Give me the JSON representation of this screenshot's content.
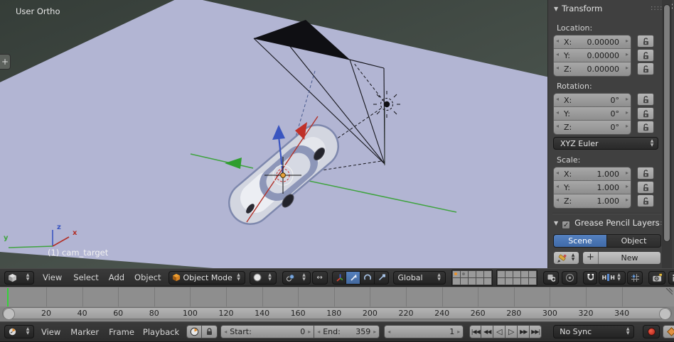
{
  "viewport": {
    "view_label": "User Ortho",
    "object_label": "(1) cam_target",
    "toolshelf_tab": "+",
    "axis_labels": {
      "x": "x",
      "y": "y",
      "z": "z"
    },
    "colors": {
      "ground_plane": "#b2b5d3",
      "selection_accent": "#e8a23c",
      "axis_x": "#b23028",
      "axis_y": "#3fa33f",
      "axis_z": "#3a55c0"
    }
  },
  "panel": {
    "transform_title": "Transform",
    "drag_dots": "::::",
    "location": {
      "label": "Location:",
      "rows": [
        {
          "axis": "X:",
          "value": "0.00000"
        },
        {
          "axis": "Y:",
          "value": "0.00000"
        },
        {
          "axis": "Z:",
          "value": "0.00000"
        }
      ]
    },
    "rotation": {
      "label": "Rotation:",
      "rows": [
        {
          "axis": "X:",
          "value": "0°"
        },
        {
          "axis": "Y:",
          "value": "0°"
        },
        {
          "axis": "Z:",
          "value": "0°"
        }
      ]
    },
    "rotation_mode": "XYZ Euler",
    "scale": {
      "label": "Scale:",
      "rows": [
        {
          "axis": "X:",
          "value": "1.000"
        },
        {
          "axis": "Y:",
          "value": "1.000"
        },
        {
          "axis": "Z:",
          "value": "1.000"
        }
      ]
    },
    "grease_pencil": {
      "title": "Grease Pencil Layers",
      "checkbox_checked": "✓",
      "tabs": [
        {
          "label": "Scene"
        },
        {
          "label": "Object"
        }
      ],
      "new_label": "New"
    }
  },
  "view3d_header": {
    "menus": [
      {
        "label": "View"
      },
      {
        "label": "Select"
      },
      {
        "label": "Add"
      },
      {
        "label": "Object"
      }
    ],
    "mode": "Object Mode",
    "orientation": "Global"
  },
  "timeline": {
    "ticks": [
      20,
      40,
      60,
      80,
      100,
      120,
      140,
      160,
      180,
      200,
      220,
      240,
      260,
      280,
      300,
      320,
      340
    ],
    "current_frame_number": 1,
    "header": {
      "menus": [
        {
          "label": "View"
        },
        {
          "label": "Marker"
        },
        {
          "label": "Frame"
        },
        {
          "label": "Playback"
        }
      ],
      "start_label": "Start:",
      "start_value": "0",
      "end_label": "End:",
      "end_value": "359",
      "current_frame": "1",
      "sync": "No Sync"
    }
  }
}
